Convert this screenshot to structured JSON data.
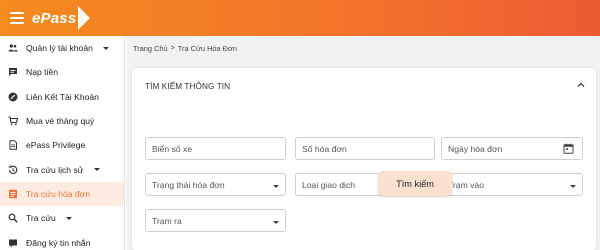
{
  "header": {
    "logo_text": "ePass"
  },
  "sidebar": {
    "items": [
      {
        "label": "Quản lý tài khoản",
        "icon": "users-icon"
      },
      {
        "label": "Nạp tiền",
        "icon": "chat-icon"
      },
      {
        "label": "Liên Kết Tài Khoản",
        "icon": "link-circle-icon"
      },
      {
        "label": "Mua vé tháng quý",
        "icon": "cart-icon"
      },
      {
        "label": "ePass Privilege",
        "icon": "document-icon"
      },
      {
        "label": "Tra cứu lịch sử",
        "icon": "history-icon"
      },
      {
        "label": "Tra cứu hóa đơn",
        "icon": "invoice-icon"
      },
      {
        "label": "Tra cứu",
        "icon": "search-icon"
      },
      {
        "label": "Đăng ký tin nhắn",
        "icon": "message-icon"
      }
    ]
  },
  "breadcrumb": {
    "home": "Trang Chủ",
    "separator": ">",
    "current": "Tra Cứu Hóa Đơn"
  },
  "search_card": {
    "title": "TÌM KIẾM THÔNG TIN",
    "fields": {
      "plate": {
        "placeholder": "Biển số xe"
      },
      "invoice_no": {
        "placeholder": "Số hóa đơn"
      },
      "invoice_date": {
        "placeholder": "Ngày hóa đơn"
      },
      "invoice_status": {
        "placeholder": "Trạng thái hóa đơn"
      },
      "transaction_type": {
        "placeholder": "Loại giao dịch"
      },
      "station_in": {
        "placeholder": "Trạm vào"
      },
      "station_out": {
        "placeholder": "Trạm ra"
      }
    },
    "search_button": "Tìm kiếm"
  },
  "colors": {
    "header_gradient_start": "#f58a1f",
    "header_gradient_end": "#ec5c33",
    "active_bg": "#fdebe1",
    "active_text": "#f07033",
    "search_button_bg": "#fbe1d0"
  }
}
